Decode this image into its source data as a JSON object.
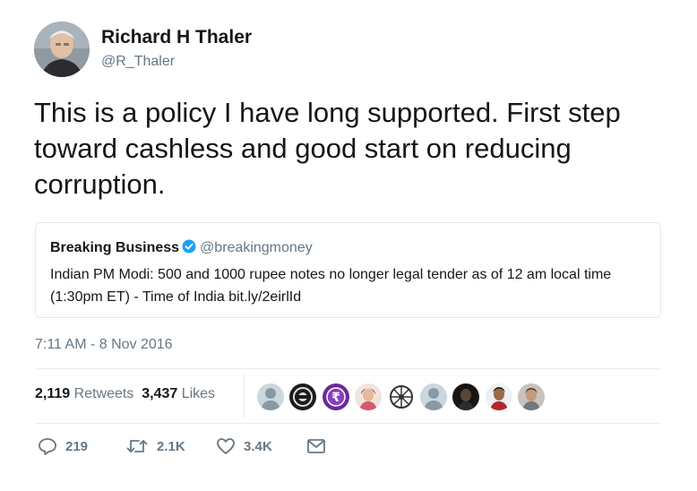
{
  "author": {
    "name": "Richard H Thaler",
    "handle": "@R_Thaler",
    "avatar_icon": "profile-photo"
  },
  "tweet": {
    "text": "This is a policy I have long supported. First step toward cashless and good start on reducing corruption."
  },
  "quoted_tweet": {
    "name": "Breaking Business",
    "verified_icon": "verified-badge-icon",
    "handle": "@breakingmoney",
    "text": "Indian PM Modi: 500 and 1000 rupee notes no longer legal tender as of 12 am local time (1:30pm ET) - Time of India bit.ly/2eirlId"
  },
  "timestamp": "7:11 AM - 8 Nov 2016",
  "stats": {
    "retweets_count": "2,119",
    "retweets_label": "Retweets",
    "likes_count": "3,437",
    "likes_label": "Likes"
  },
  "likers": [
    {
      "icon": "default-avatar",
      "color": "#c4cdd4"
    },
    {
      "icon": "black-logo-avatar",
      "color": "#222222"
    },
    {
      "icon": "rupee-avatar",
      "color": "#6b2a9a"
    },
    {
      "icon": "photo-avatar",
      "color": "#e8c3b5"
    },
    {
      "icon": "wheel-avatar",
      "color": "#555555"
    },
    {
      "icon": "default-avatar",
      "color": "#c4cdd4"
    },
    {
      "icon": "dark-photo-avatar",
      "color": "#1a1a1a"
    },
    {
      "icon": "photo-avatar",
      "color": "#8a5a3c"
    },
    {
      "icon": "photo-avatar",
      "color": "#9a8f88"
    }
  ],
  "actions": {
    "reply_icon": "reply-icon",
    "reply_count": "219",
    "retweet_icon": "retweet-icon",
    "retweet_count": "2.1K",
    "like_icon": "heart-icon",
    "like_count": "3.4K",
    "dm_icon": "envelope-icon"
  },
  "colors": {
    "text": "#14171a",
    "secondary": "#657786",
    "border": "#e1e8ed",
    "verified": "#1da1f2"
  }
}
